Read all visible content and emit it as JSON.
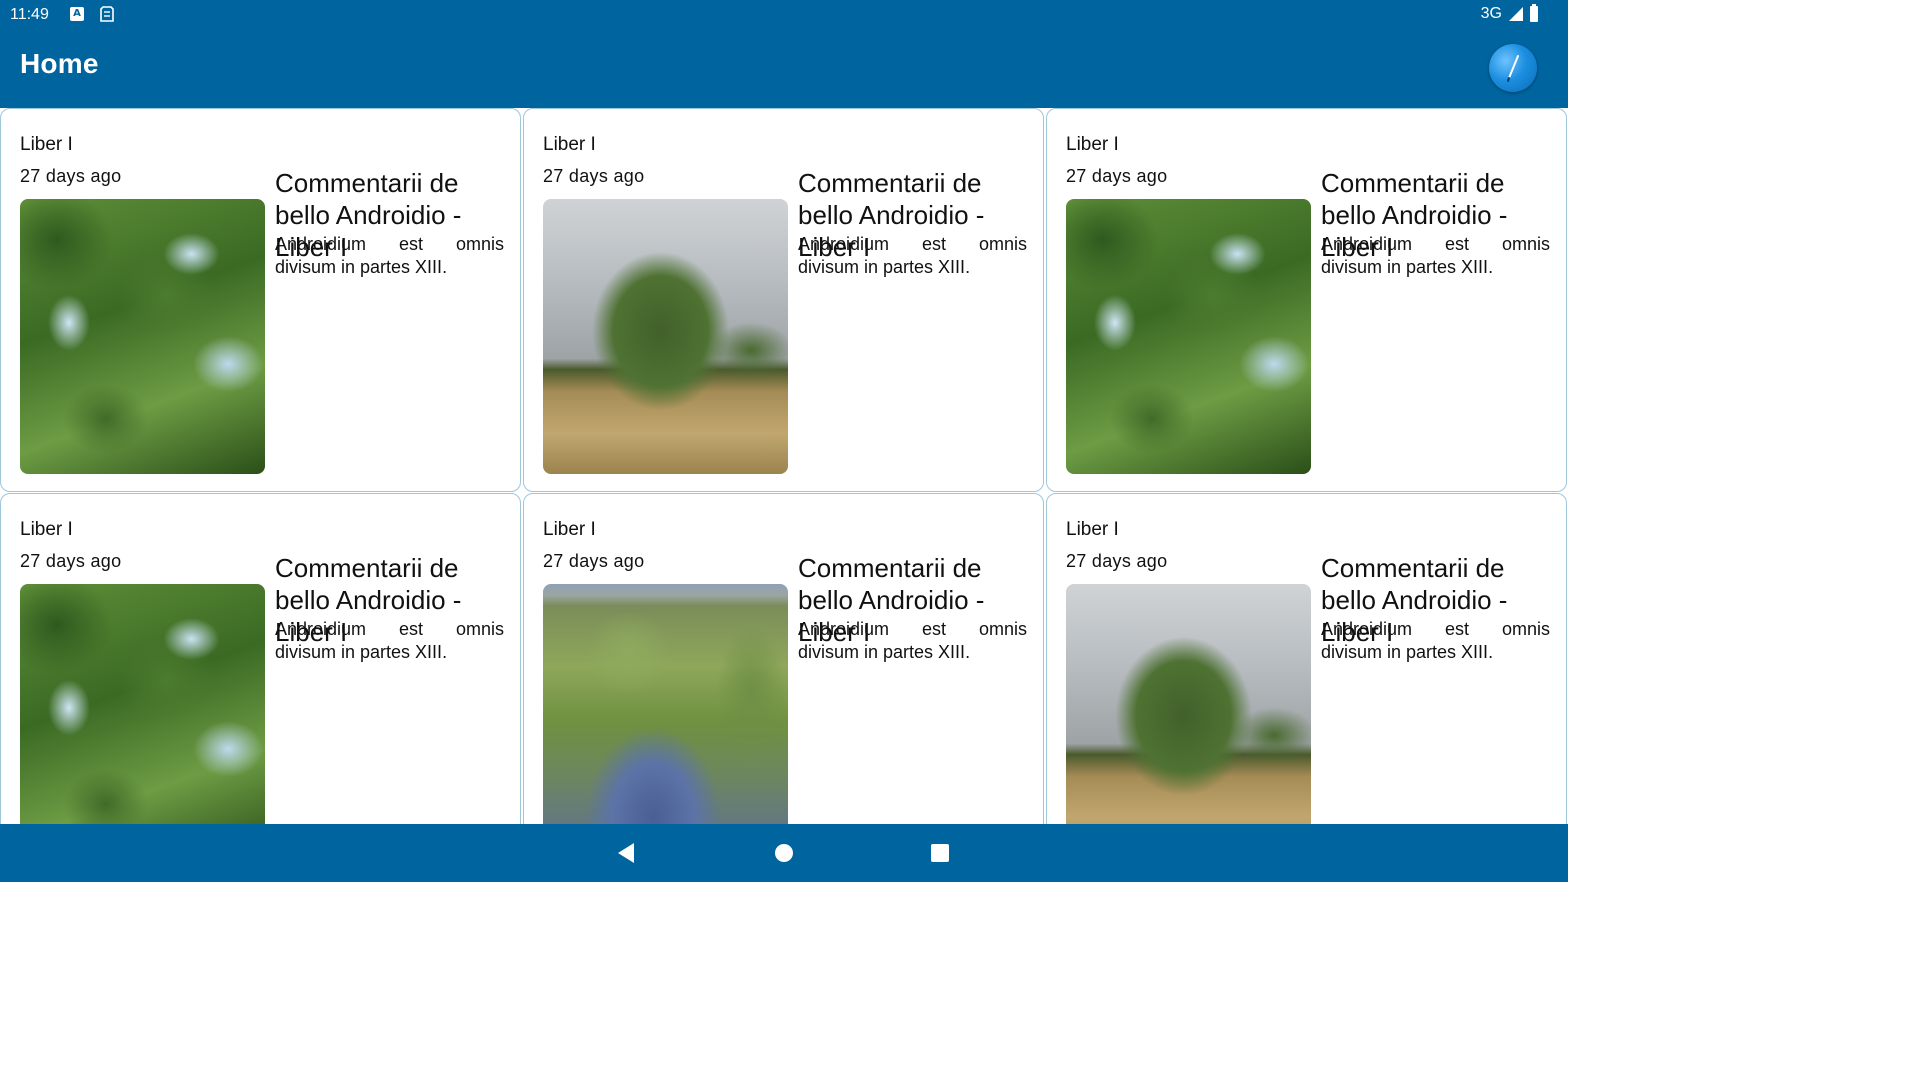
{
  "status_bar": {
    "time": "11:49",
    "network": "3G",
    "icons": [
      "keyboard-a-icon",
      "sd-card-icon",
      "signal-icon",
      "battery-icon"
    ]
  },
  "app_bar": {
    "title": "Home",
    "color": "#00649f"
  },
  "cards": [
    {
      "book": "Liber I",
      "date": "27 days ago",
      "title": "Commentarii de bello Androidio - Liber I",
      "description": "Androidium est omnis divisum in partes XIII.",
      "image": "tree-canopy"
    },
    {
      "book": "Liber I",
      "date": "27 days ago",
      "title": "Commentarii de bello Androidio - Liber I",
      "description": "Androidium est omnis divisum in partes XIII.",
      "image": "tree-in-field"
    },
    {
      "book": "Liber I",
      "date": "27 days ago",
      "title": "Commentarii de bello Androidio - Liber I",
      "description": "Androidium est omnis divisum in partes XIII.",
      "image": "tree-canopy"
    },
    {
      "book": "Liber I",
      "date": "27 days ago",
      "title": "Commentarii de bello Androidio - Liber I",
      "description": "Androidium est omnis divisum in partes XIII.",
      "image": "tree-canopy"
    },
    {
      "book": "Liber I",
      "date": "27 days ago",
      "title": "Commentarii de bello Androidio - Liber I",
      "description": "Androidium est omnis divisum in partes XIII.",
      "image": "stream"
    },
    {
      "book": "Liber I",
      "date": "27 days ago",
      "title": "Commentarii de bello Androidio - Liber I",
      "description": "Androidium est omnis divisum in partes XIII.",
      "image": "tree-in-field"
    }
  ],
  "nav_bar": {
    "buttons": [
      "back-icon",
      "home-icon",
      "recents-icon"
    ]
  }
}
